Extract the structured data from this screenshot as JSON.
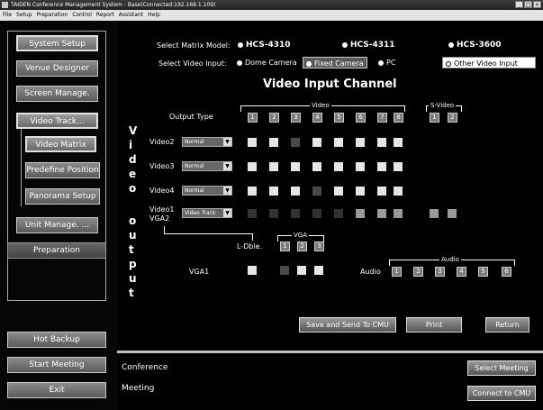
{
  "window": {
    "title": "TAIDEN Conference Management System - Base(Connected:192.168.1.109)",
    "controls": [
      "_",
      "□",
      "×"
    ]
  },
  "menu": [
    "File",
    "Setup",
    "Preparation",
    "Control",
    "Report",
    "Assistant",
    "Help"
  ],
  "sidebar": {
    "items": [
      {
        "label": "System Setup"
      },
      {
        "label": "Venue Designer"
      },
      {
        "label": "Screen Manage."
      },
      {
        "label": "Video Track..."
      },
      {
        "label": "Video Matrix"
      },
      {
        "label": "Predefine Position"
      },
      {
        "label": "Panorama Setup"
      },
      {
        "label": "Unit Manage. ..."
      },
      {
        "label": "Preparation"
      },
      {
        "label": "Hot Backup"
      },
      {
        "label": "Start Meeting"
      },
      {
        "label": "Exit"
      }
    ]
  },
  "matrix_model": {
    "label": "Select Matrix Model:",
    "options": [
      "HCS-4310",
      "HCS-4311",
      "HCS-3600"
    ]
  },
  "video_input": {
    "label": "Select Video Input:",
    "options": [
      "Dome Camera",
      "Fixed Camera",
      "PC",
      "Other Video Input"
    ]
  },
  "heading": "Video Input Channel",
  "vertical_label": [
    "V",
    "i",
    "d",
    "e",
    "o",
    "o",
    "u",
    "t",
    "p",
    "u",
    "t"
  ],
  "output_type_label": "Output Type",
  "video_bracket": "Video",
  "svideo_bracket": "S-Video",
  "video_numbers": [
    "1",
    "2",
    "3",
    "4",
    "5",
    "6",
    "7",
    "8"
  ],
  "svideo_numbers": [
    "1",
    "2"
  ],
  "rows": [
    {
      "label": "Video2",
      "mode": "Normal"
    },
    {
      "label": "Video3",
      "mode": "Normal"
    },
    {
      "label": "Video4",
      "mode": "Normal"
    },
    {
      "label": "Video1",
      "mode": "Video Track"
    }
  ],
  "vga2_label": "VGA2",
  "ldble_label": "L-Dble.",
  "vga_bracket": "VGA",
  "vga_numbers": [
    "1",
    "2",
    "3"
  ],
  "vga1_label": "VGA1",
  "audio_label": "Audio",
  "audio_bracket": "Audio",
  "audio_numbers": [
    "1",
    "2",
    "3",
    "4",
    "5",
    "6"
  ],
  "buttons": {
    "save": "Save and Send To CMU",
    "print": "Print",
    "return": "Return",
    "select_meeting": "Select Meeting",
    "connect": "Connect to CMU"
  },
  "status": {
    "conference": "Conference",
    "meeting": "Meeting"
  }
}
